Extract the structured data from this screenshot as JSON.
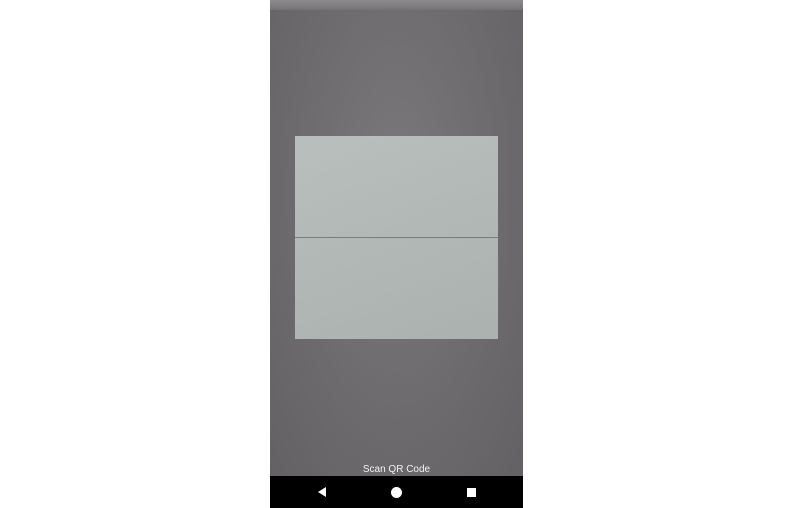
{
  "scanner": {
    "label": "Scan QR Code"
  },
  "navigation": {
    "back_icon": "back-triangle-icon",
    "home_icon": "home-circle-icon",
    "recents_icon": "recents-square-icon"
  },
  "colors": {
    "camera_background": "#6f6d70",
    "scan_frame": "#b5bbb9",
    "laser_line": "#e0524a",
    "nav_bar": "#000000",
    "label_text": "#f2f2f2"
  }
}
